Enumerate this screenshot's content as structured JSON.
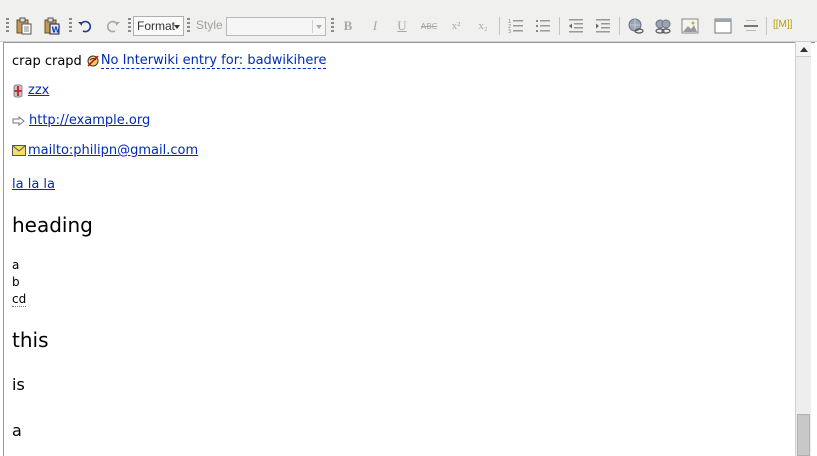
{
  "toolbar": {
    "format_label": "Format",
    "style_label": "Style",
    "style_value": "",
    "bold_label": "B",
    "italic_label": "I",
    "underline_label": "U",
    "strike_label": "ABC",
    "superscript_label": "x²",
    "subscript_label": "x₂",
    "wikilink_label": "[[M]]"
  },
  "content": {
    "line1_text": "crap crapd",
    "line1_link": "No Interwiki entry for: badwikihere",
    "line2_link": "zzx",
    "line3_link": "http://example.org",
    "line4_link": "mailto:philipn@gmail.com",
    "line5_link": "la la la",
    "heading1": "heading",
    "list_a": "a",
    "list_b": "b",
    "list_c": "cd",
    "heading2": "this",
    "heading3": "is",
    "heading4": "a"
  },
  "colors": {
    "link": "#002bb8",
    "toolbar_bg": "#f0f0ee"
  },
  "icons": [
    "paste-icon",
    "paste-word-icon",
    "undo-icon",
    "redo-icon",
    "bold-icon",
    "italic-icon",
    "underline-icon",
    "strikethrough-icon",
    "superscript-icon",
    "subscript-icon",
    "ordered-list-icon",
    "unordered-list-icon",
    "outdent-icon",
    "indent-icon",
    "link-icon",
    "unlink-icon",
    "image-icon",
    "table-icon",
    "horizontal-rule-icon",
    "wikilink-icon",
    "interwiki-icon",
    "flag-icon",
    "external-link-icon",
    "mail-icon"
  ]
}
